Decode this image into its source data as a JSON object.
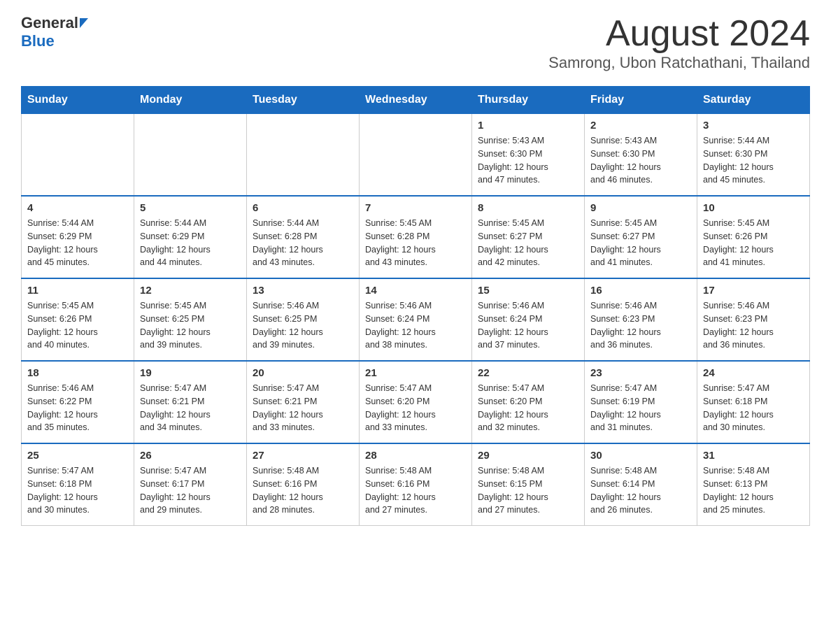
{
  "logo": {
    "text_general": "General",
    "text_blue": "Blue"
  },
  "title": "August 2024",
  "subtitle": "Samrong, Ubon Ratchathani, Thailand",
  "weekdays": [
    "Sunday",
    "Monday",
    "Tuesday",
    "Wednesday",
    "Thursday",
    "Friday",
    "Saturday"
  ],
  "weeks": [
    [
      {
        "day": "",
        "info": ""
      },
      {
        "day": "",
        "info": ""
      },
      {
        "day": "",
        "info": ""
      },
      {
        "day": "",
        "info": ""
      },
      {
        "day": "1",
        "info": "Sunrise: 5:43 AM\nSunset: 6:30 PM\nDaylight: 12 hours\nand 47 minutes."
      },
      {
        "day": "2",
        "info": "Sunrise: 5:43 AM\nSunset: 6:30 PM\nDaylight: 12 hours\nand 46 minutes."
      },
      {
        "day": "3",
        "info": "Sunrise: 5:44 AM\nSunset: 6:30 PM\nDaylight: 12 hours\nand 45 minutes."
      }
    ],
    [
      {
        "day": "4",
        "info": "Sunrise: 5:44 AM\nSunset: 6:29 PM\nDaylight: 12 hours\nand 45 minutes."
      },
      {
        "day": "5",
        "info": "Sunrise: 5:44 AM\nSunset: 6:29 PM\nDaylight: 12 hours\nand 44 minutes."
      },
      {
        "day": "6",
        "info": "Sunrise: 5:44 AM\nSunset: 6:28 PM\nDaylight: 12 hours\nand 43 minutes."
      },
      {
        "day": "7",
        "info": "Sunrise: 5:45 AM\nSunset: 6:28 PM\nDaylight: 12 hours\nand 43 minutes."
      },
      {
        "day": "8",
        "info": "Sunrise: 5:45 AM\nSunset: 6:27 PM\nDaylight: 12 hours\nand 42 minutes."
      },
      {
        "day": "9",
        "info": "Sunrise: 5:45 AM\nSunset: 6:27 PM\nDaylight: 12 hours\nand 41 minutes."
      },
      {
        "day": "10",
        "info": "Sunrise: 5:45 AM\nSunset: 6:26 PM\nDaylight: 12 hours\nand 41 minutes."
      }
    ],
    [
      {
        "day": "11",
        "info": "Sunrise: 5:45 AM\nSunset: 6:26 PM\nDaylight: 12 hours\nand 40 minutes."
      },
      {
        "day": "12",
        "info": "Sunrise: 5:45 AM\nSunset: 6:25 PM\nDaylight: 12 hours\nand 39 minutes."
      },
      {
        "day": "13",
        "info": "Sunrise: 5:46 AM\nSunset: 6:25 PM\nDaylight: 12 hours\nand 39 minutes."
      },
      {
        "day": "14",
        "info": "Sunrise: 5:46 AM\nSunset: 6:24 PM\nDaylight: 12 hours\nand 38 minutes."
      },
      {
        "day": "15",
        "info": "Sunrise: 5:46 AM\nSunset: 6:24 PM\nDaylight: 12 hours\nand 37 minutes."
      },
      {
        "day": "16",
        "info": "Sunrise: 5:46 AM\nSunset: 6:23 PM\nDaylight: 12 hours\nand 36 minutes."
      },
      {
        "day": "17",
        "info": "Sunrise: 5:46 AM\nSunset: 6:23 PM\nDaylight: 12 hours\nand 36 minutes."
      }
    ],
    [
      {
        "day": "18",
        "info": "Sunrise: 5:46 AM\nSunset: 6:22 PM\nDaylight: 12 hours\nand 35 minutes."
      },
      {
        "day": "19",
        "info": "Sunrise: 5:47 AM\nSunset: 6:21 PM\nDaylight: 12 hours\nand 34 minutes."
      },
      {
        "day": "20",
        "info": "Sunrise: 5:47 AM\nSunset: 6:21 PM\nDaylight: 12 hours\nand 33 minutes."
      },
      {
        "day": "21",
        "info": "Sunrise: 5:47 AM\nSunset: 6:20 PM\nDaylight: 12 hours\nand 33 minutes."
      },
      {
        "day": "22",
        "info": "Sunrise: 5:47 AM\nSunset: 6:20 PM\nDaylight: 12 hours\nand 32 minutes."
      },
      {
        "day": "23",
        "info": "Sunrise: 5:47 AM\nSunset: 6:19 PM\nDaylight: 12 hours\nand 31 minutes."
      },
      {
        "day": "24",
        "info": "Sunrise: 5:47 AM\nSunset: 6:18 PM\nDaylight: 12 hours\nand 30 minutes."
      }
    ],
    [
      {
        "day": "25",
        "info": "Sunrise: 5:47 AM\nSunset: 6:18 PM\nDaylight: 12 hours\nand 30 minutes."
      },
      {
        "day": "26",
        "info": "Sunrise: 5:47 AM\nSunset: 6:17 PM\nDaylight: 12 hours\nand 29 minutes."
      },
      {
        "day": "27",
        "info": "Sunrise: 5:48 AM\nSunset: 6:16 PM\nDaylight: 12 hours\nand 28 minutes."
      },
      {
        "day": "28",
        "info": "Sunrise: 5:48 AM\nSunset: 6:16 PM\nDaylight: 12 hours\nand 27 minutes."
      },
      {
        "day": "29",
        "info": "Sunrise: 5:48 AM\nSunset: 6:15 PM\nDaylight: 12 hours\nand 27 minutes."
      },
      {
        "day": "30",
        "info": "Sunrise: 5:48 AM\nSunset: 6:14 PM\nDaylight: 12 hours\nand 26 minutes."
      },
      {
        "day": "31",
        "info": "Sunrise: 5:48 AM\nSunset: 6:13 PM\nDaylight: 12 hours\nand 25 minutes."
      }
    ]
  ]
}
